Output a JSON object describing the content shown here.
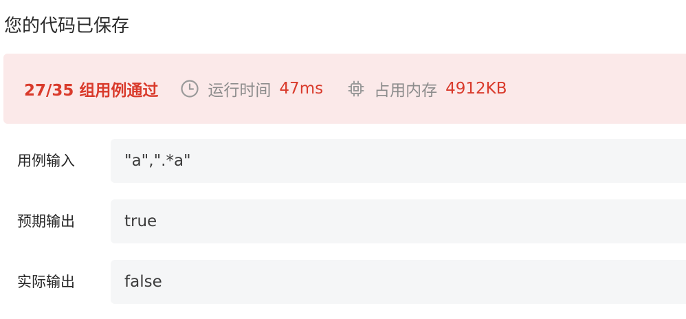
{
  "header": {
    "saved_text": "您的代码已保存"
  },
  "result": {
    "pass_count_text": "27/35 组用例通过",
    "runtime": {
      "icon": "clock-icon",
      "label": "运行时间",
      "value": "47ms"
    },
    "memory": {
      "icon": "chip-icon",
      "label": "占用内存",
      "value": "4912KB"
    },
    "colors": {
      "fail_accent": "#d93a2b",
      "banner_background": "#fbe9e9",
      "muted": "#8c8c8c"
    }
  },
  "testcase": {
    "input_label": "用例输入",
    "input_value": "\"a\",\".*a\"",
    "expected_label": "预期输出",
    "expected_value": "true",
    "actual_label": "实际输出",
    "actual_value": "false"
  }
}
